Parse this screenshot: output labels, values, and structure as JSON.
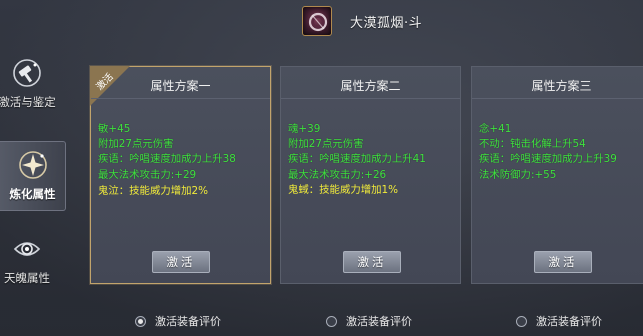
{
  "header": {
    "item_title": "大漠孤烟·斗",
    "item_icon": "dark-ring-icon"
  },
  "sidebar": {
    "items": [
      {
        "label": "激活与鉴定",
        "icon": "hammer-icon",
        "active": false
      },
      {
        "label": "炼化属性",
        "icon": "sparkle-icon",
        "active": true
      },
      {
        "label": "天魄属性",
        "icon": "spirit-eye-icon",
        "active": false
      }
    ]
  },
  "cards": [
    {
      "title": "属性方案一",
      "badge": "激活",
      "selected": true,
      "attributes": [
        "敏+45",
        "附加27点元伤害",
        "疾语：吟唱速度加成力上升38",
        "最大法术攻击力:+29"
      ],
      "special": "鬼泣：技能威力增加2%",
      "button": "激活"
    },
    {
      "title": "属性方案二",
      "selected": false,
      "attributes": [
        "魂+39",
        "附加27点元伤害",
        "疾语：吟唱速度加成力上升41",
        "最大法术攻击力:+26"
      ],
      "special": "鬼蜮：技能威力增加1%",
      "button": "激活"
    },
    {
      "title": "属性方案三",
      "selected": false,
      "attributes": [
        "念+41",
        "不动：钝击化解上升54",
        "疾语：吟唱速度加成力上升39",
        "法术防御力:+55"
      ],
      "special": "",
      "button": "激活"
    }
  ],
  "radios": [
    {
      "label": "激活装备评价",
      "checked": true
    },
    {
      "label": "激活装备评价",
      "checked": false
    },
    {
      "label": "激活装备评价",
      "checked": false
    }
  ],
  "colors": {
    "attribute_text": "#3fe23f",
    "special_text": "#f0ea3a",
    "selected_border": "#c2a46c"
  }
}
